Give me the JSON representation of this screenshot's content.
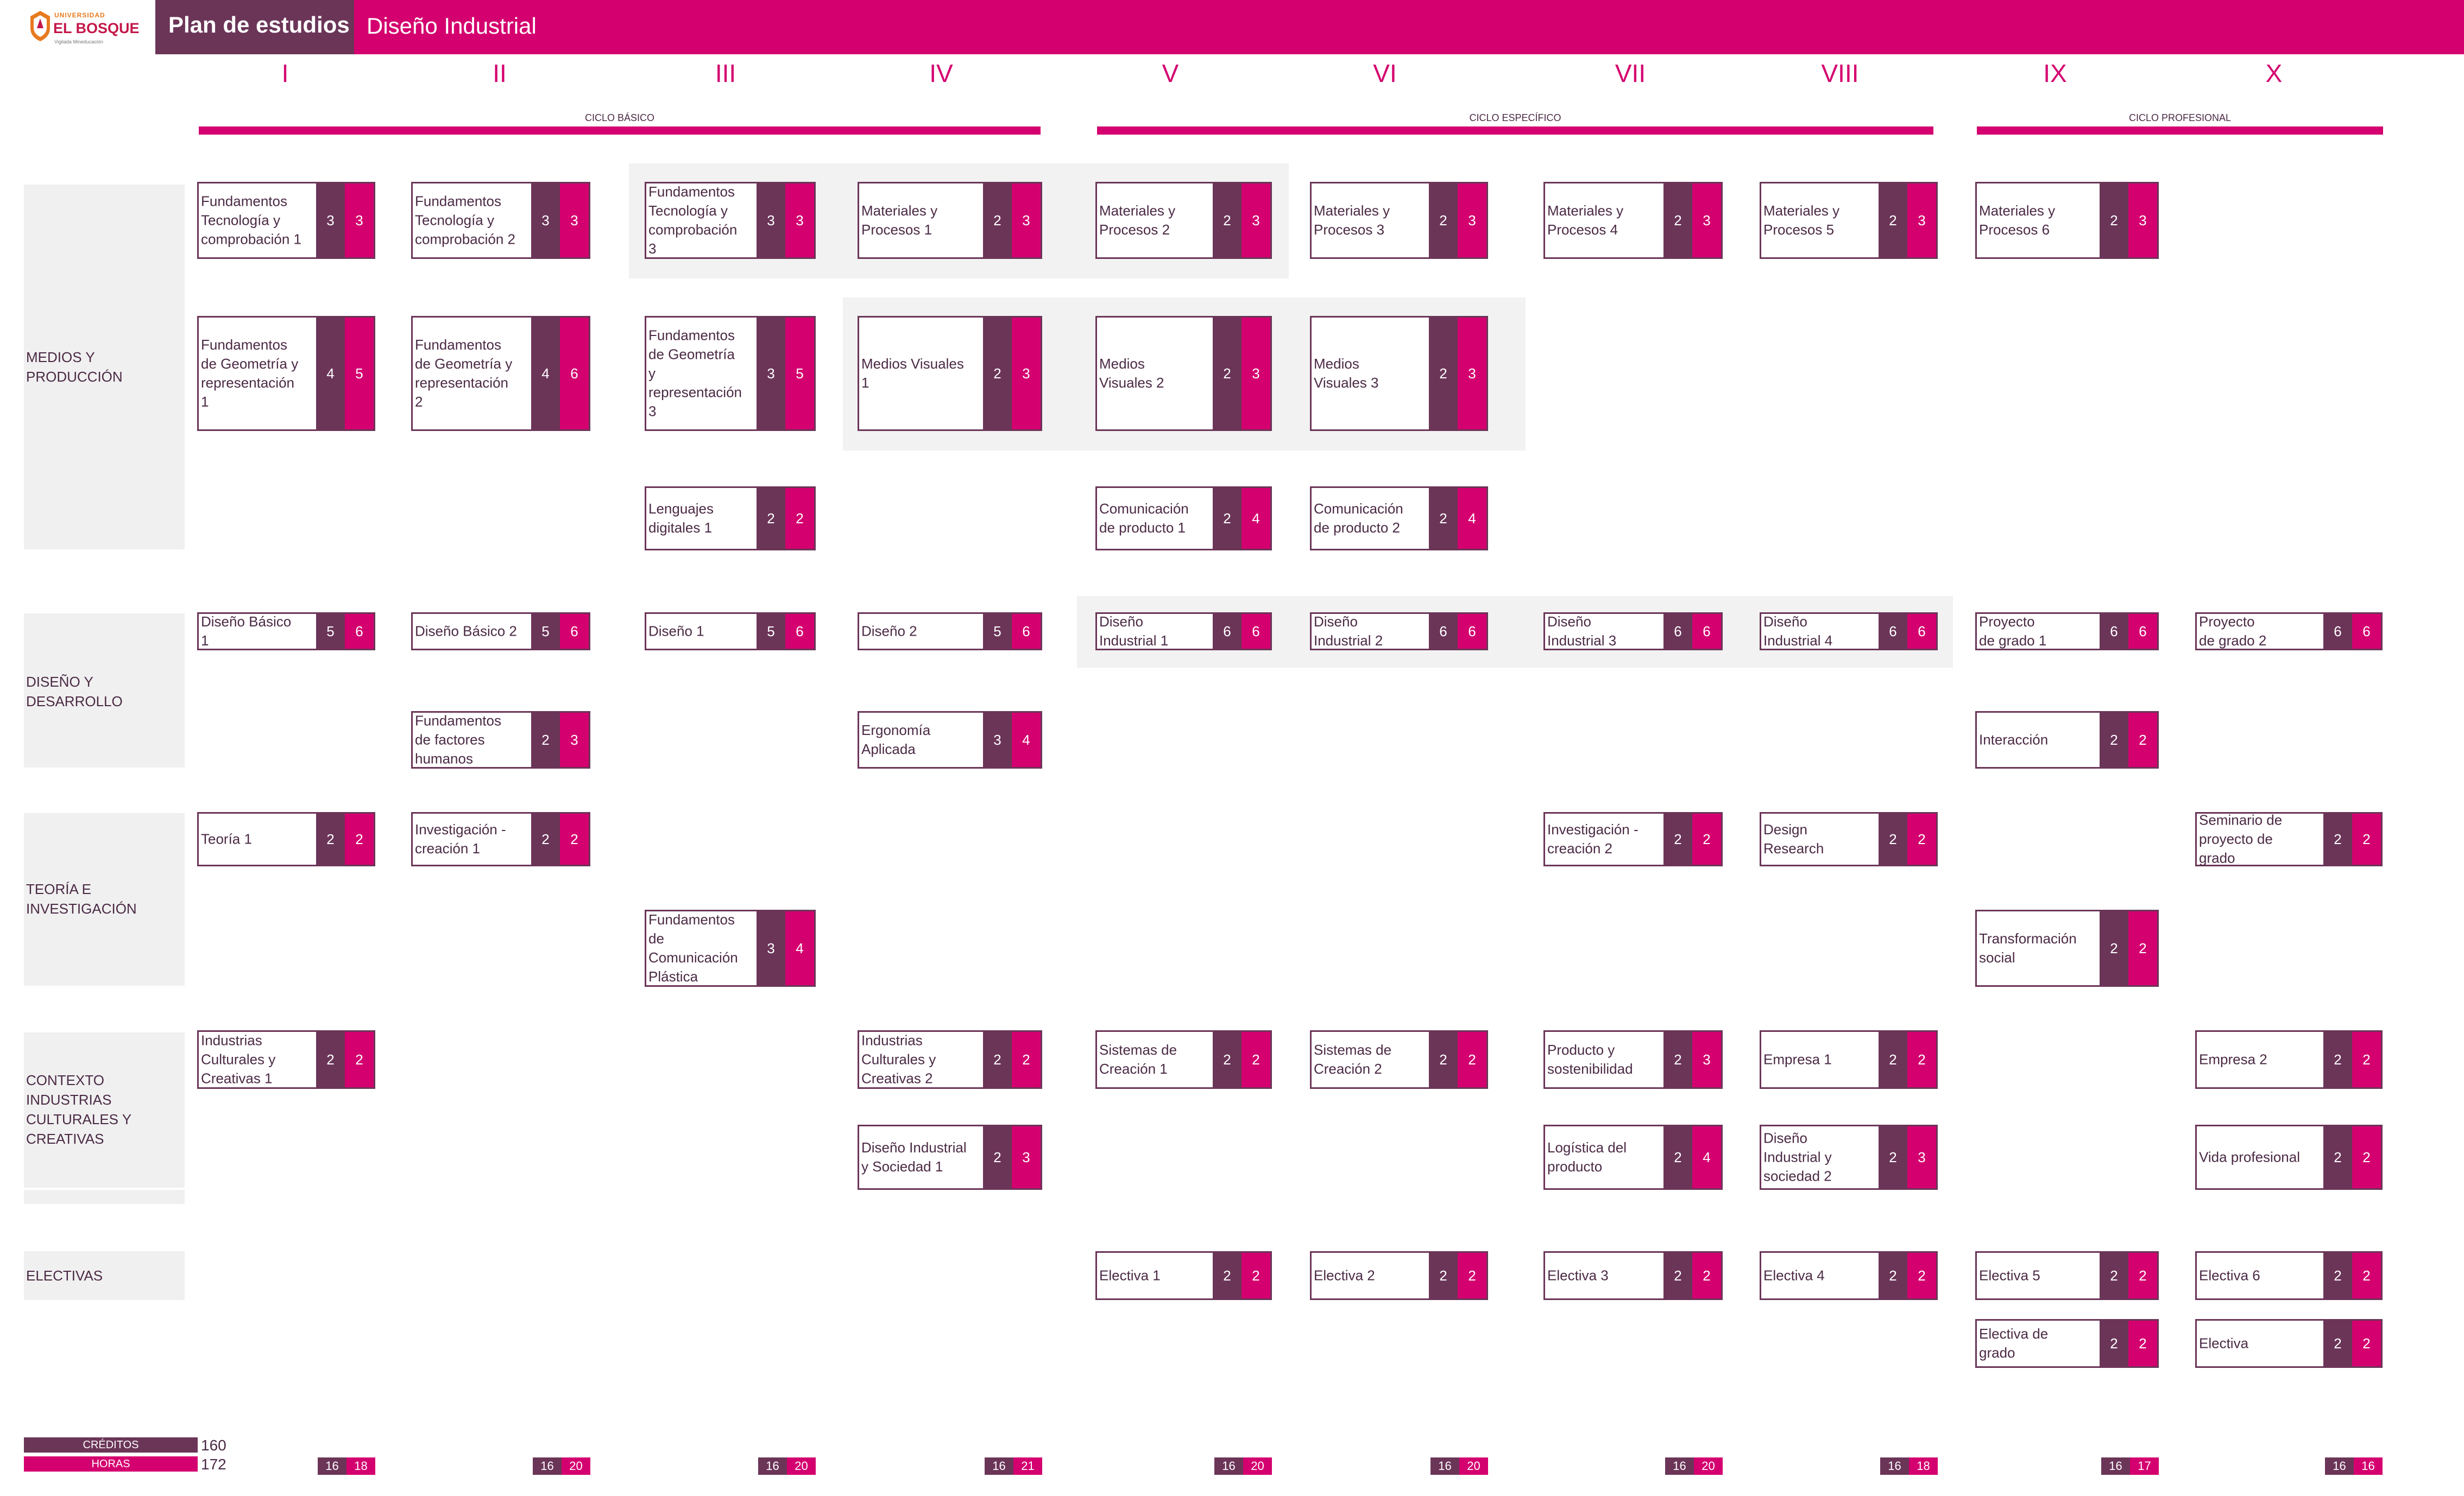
{
  "header": {
    "logo": {
      "small": "UNIVERSIDAD",
      "big": "EL BOSQUE",
      "tag": "Vigilada Mineducación"
    },
    "title": "Plan de estudios",
    "program": "Diseño Industrial"
  },
  "semesters": [
    "I",
    "II",
    "III",
    "IV",
    "V",
    "VI",
    "VII",
    "VIII",
    "IX",
    "X"
  ],
  "cycles": [
    {
      "label": "CICLO BÁSICO"
    },
    {
      "label": "CICLO ESPECÍFICO"
    },
    {
      "label": "CICLO PROFESIONAL"
    }
  ],
  "categories": [
    {
      "label": "MEDIOS Y\nPRODUCCIÓN"
    },
    {
      "label": "DISEÑO Y\nDESARROLLO"
    },
    {
      "label": "TEORÍA E\nINVESTIGACIÓN"
    },
    {
      "label": "CONTEXTO\nINDUSTRIAS\nCULTURALES Y\nCREATIVAS"
    },
    {
      "label": ""
    },
    {
      "label": "ELECTIVAS"
    }
  ],
  "courses": [
    {
      "name": "Fundamentos\nTecnología y\ncomprobación 1",
      "credits": "3",
      "hours": "3"
    },
    {
      "name": "Fundamentos\nTecnología y\ncomprobación 2",
      "credits": "3",
      "hours": "3"
    },
    {
      "name": "Fundamentos\nTecnología y\ncomprobación\n3",
      "credits": "3",
      "hours": "3"
    },
    {
      "name": "Materiales y\nProcesos 1",
      "credits": "2",
      "hours": "3"
    },
    {
      "name": "Materiales y\nProcesos 2",
      "credits": "2",
      "hours": "3"
    },
    {
      "name": "Materiales y\nProcesos 3",
      "credits": "2",
      "hours": "3"
    },
    {
      "name": "Materiales y\nProcesos 4",
      "credits": "2",
      "hours": "3"
    },
    {
      "name": "Materiales y\nProcesos 5",
      "credits": "2",
      "hours": "3"
    },
    {
      "name": "Materiales y\nProcesos 6",
      "credits": "2",
      "hours": "3"
    },
    {
      "name": "Fundamentos\nde Geometría y\nrepresentación\n1",
      "credits": "4",
      "hours": "5"
    },
    {
      "name": "Fundamentos\nde Geometría y\nrepresentación\n2",
      "credits": "4",
      "hours": "6"
    },
    {
      "name": "Fundamentos\nde Geometría\ny\nrepresentación\n3",
      "credits": "3",
      "hours": "5"
    },
    {
      "name": "Medios Visuales\n1",
      "credits": "2",
      "hours": "3"
    },
    {
      "name": "Medios\nVisuales 2",
      "credits": "2",
      "hours": "3"
    },
    {
      "name": "Medios\nVisuales 3",
      "credits": "2",
      "hours": "3"
    },
    {
      "name": "Lenguajes\ndigitales 1",
      "credits": "2",
      "hours": "2"
    },
    {
      "name": "Comunicación\nde producto 1",
      "credits": "2",
      "hours": "4"
    },
    {
      "name": "Comunicación\nde producto 2",
      "credits": "2",
      "hours": "4"
    },
    {
      "name": "Diseño Básico\n1",
      "credits": "5",
      "hours": "6"
    },
    {
      "name": "Diseño Básico 2",
      "credits": "5",
      "hours": "6"
    },
    {
      "name": "Diseño 1",
      "credits": "5",
      "hours": "6"
    },
    {
      "name": "Diseño 2",
      "credits": "5",
      "hours": "6"
    },
    {
      "name": "Diseño\nIndustrial 1",
      "credits": "6",
      "hours": "6"
    },
    {
      "name": "Diseño\nIndustrial 2",
      "credits": "6",
      "hours": "6"
    },
    {
      "name": "Diseño\nIndustrial 3",
      "credits": "6",
      "hours": "6"
    },
    {
      "name": "Diseño\nIndustrial 4",
      "credits": "6",
      "hours": "6"
    },
    {
      "name": "Proyecto\nde grado 1",
      "credits": "6",
      "hours": "6"
    },
    {
      "name": "Proyecto\nde grado 2",
      "credits": "6",
      "hours": "6"
    },
    {
      "name": "Fundamentos\nde factores\nhumanos",
      "credits": "2",
      "hours": "3"
    },
    {
      "name": "Ergonomía\nAplicada",
      "credits": "3",
      "hours": "4"
    },
    {
      "name": "Interacción",
      "credits": "2",
      "hours": "2"
    },
    {
      "name": "Teoría 1",
      "credits": "2",
      "hours": "2"
    },
    {
      "name": "Investigación -\ncreación 1",
      "credits": "2",
      "hours": "2"
    },
    {
      "name": "Investigación -\ncreación 2",
      "credits": "2",
      "hours": "2"
    },
    {
      "name": "Design\nResearch",
      "credits": "2",
      "hours": "2"
    },
    {
      "name": "Seminario de\nproyecto de\ngrado",
      "credits": "2",
      "hours": "2"
    },
    {
      "name": "Fundamentos\nde\nComunicación\nPlástica",
      "credits": "3",
      "hours": "4"
    },
    {
      "name": "Transformación\nsocial",
      "credits": "2",
      "hours": "2"
    },
    {
      "name": "Industrias\nCulturales y\nCreativas 1",
      "credits": "2",
      "hours": "2"
    },
    {
      "name": "Industrias\nCulturales y\nCreativas 2",
      "credits": "2",
      "hours": "2"
    },
    {
      "name": "Sistemas de\nCreación 1",
      "credits": "2",
      "hours": "2"
    },
    {
      "name": "Sistemas de\nCreación 2",
      "credits": "2",
      "hours": "2"
    },
    {
      "name": "Producto y\nsostenibilidad",
      "credits": "2",
      "hours": "3"
    },
    {
      "name": "Empresa 1",
      "credits": "2",
      "hours": "2"
    },
    {
      "name": "Empresa 2",
      "credits": "2",
      "hours": "2"
    },
    {
      "name": "Diseño Industrial\ny Sociedad 1",
      "credits": "2",
      "hours": "3"
    },
    {
      "name": "Logística del\nproducto",
      "credits": "2",
      "hours": "4"
    },
    {
      "name": "Diseño\nIndustrial y\nsociedad 2",
      "credits": "2",
      "hours": "3"
    },
    {
      "name": "Vida profesional",
      "credits": "2",
      "hours": "2"
    },
    {
      "name": "Electiva 1",
      "credits": "2",
      "hours": "2"
    },
    {
      "name": "Electiva 2",
      "credits": "2",
      "hours": "2"
    },
    {
      "name": "Electiva 3",
      "credits": "2",
      "hours": "2"
    },
    {
      "name": "Electiva 4",
      "credits": "2",
      "hours": "2"
    },
    {
      "name": "Electiva 5",
      "credits": "2",
      "hours": "2"
    },
    {
      "name": "Electiva 6",
      "credits": "2",
      "hours": "2"
    },
    {
      "name": "Electiva de\ngrado",
      "credits": "2",
      "hours": "2"
    },
    {
      "name": "Electiva",
      "credits": "2",
      "hours": "2"
    }
  ],
  "summary": {
    "credits_label": "CRÉDITOS",
    "hours_label": "HORAS",
    "total_credits": "160",
    "total_hours": "172",
    "semester_totals": [
      {
        "credits": "16",
        "hours": "18"
      },
      {
        "credits": "16",
        "hours": "20"
      },
      {
        "credits": "16",
        "hours": "20"
      },
      {
        "credits": "16",
        "hours": "21"
      },
      {
        "credits": "16",
        "hours": "20"
      },
      {
        "credits": "16",
        "hours": "20"
      },
      {
        "credits": "16",
        "hours": "20"
      },
      {
        "credits": "16",
        "hours": "18"
      },
      {
        "credits": "16",
        "hours": "17"
      },
      {
        "credits": "16",
        "hours": "16"
      }
    ]
  },
  "colors": {
    "magenta": "#d4006f",
    "plum": "#6b3558",
    "highlight": "#f2f2f2"
  }
}
